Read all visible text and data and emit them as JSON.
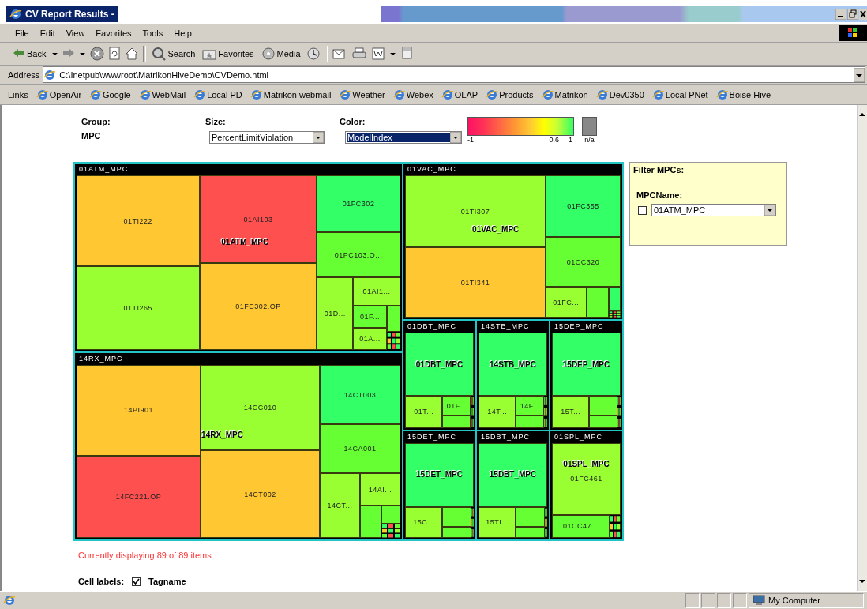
{
  "window": {
    "title": "CV Report Results -"
  },
  "menu": [
    "File",
    "Edit",
    "View",
    "Favorites",
    "Tools",
    "Help"
  ],
  "toolbar": [
    {
      "kind": "back",
      "label": "Back"
    },
    {
      "kind": "caret"
    },
    {
      "kind": "forward"
    },
    {
      "kind": "caret"
    },
    {
      "kind": "stop"
    },
    {
      "kind": "refresh"
    },
    {
      "kind": "home"
    },
    {
      "kind": "separator"
    },
    {
      "kind": "search",
      "label": "Search"
    },
    {
      "kind": "favorites",
      "label": "Favorites"
    },
    {
      "kind": "media",
      "label": "Media"
    },
    {
      "kind": "history"
    },
    {
      "kind": "separator"
    },
    {
      "kind": "mail"
    },
    {
      "kind": "print"
    },
    {
      "kind": "edit"
    },
    {
      "kind": "caret"
    },
    {
      "kind": "discuss"
    }
  ],
  "address": {
    "label": "Address",
    "value": "C:\\Inetpub\\wwwroot\\MatrikonHiveDemo\\CVDemo.html"
  },
  "links": {
    "label": "Links",
    "items": [
      "OpenAir",
      "Google",
      "WebMail",
      "Local PD",
      "Matrikon webmail",
      "Weather",
      "Webex",
      "OLAP",
      "Products",
      "Matrikon",
      "Dev0350",
      "Local PNet",
      "Boise Hive"
    ]
  },
  "controls": {
    "group": {
      "label": "Group:",
      "value": "MPC"
    },
    "size": {
      "label": "Size:",
      "value": "PercentLimitViolation",
      "highlighted": false
    },
    "color": {
      "label": "Color:",
      "value": "ModelIndex",
      "highlighted": true
    },
    "legend": {
      "ticks": [
        "-1",
        "0.6",
        "1"
      ],
      "na": "n/a"
    }
  },
  "treemap": {
    "groups": [
      {
        "title": "01ATM_MPC",
        "overlay_label": "01ATM_MPC",
        "cells": [
          {
            "kind": "tile",
            "label": "01TI222",
            "color": "#ffc833"
          },
          {
            "kind": "tile",
            "label": "01TI265",
            "color": "#99ff33"
          },
          {
            "kind": "tile",
            "label": "01AI103",
            "color": "#ff5050"
          },
          {
            "kind": "tile",
            "label": "01FC302.OP",
            "color": "#ffc833"
          },
          {
            "kind": "tile",
            "label": "01FC302",
            "color": "#33ff66"
          },
          {
            "kind": "tile",
            "label": "01PC103.O...",
            "color": "#66ff33"
          },
          {
            "kind": "tile",
            "label": "01D...",
            "color": "#99ff33"
          },
          {
            "kind": "tile",
            "label": "01AI1...",
            "color": "#99ff33"
          },
          {
            "kind": "tile",
            "label": "01F...",
            "color": "#66ff33"
          },
          {
            "kind": "tile",
            "label": "01A...",
            "color": "#99ff33"
          },
          {
            "kind": "tile",
            "color": "#66ff33"
          },
          {
            "kind": "mosaic"
          }
        ]
      },
      {
        "title": "01VAC_MPC",
        "overlay_label": "01VAC_MPC",
        "cells": [
          {
            "kind": "tile",
            "label": "01TI307",
            "color": "#99ff33"
          },
          {
            "kind": "tile",
            "label": "01TI341",
            "color": "#ffc833"
          },
          {
            "kind": "tile",
            "label": "01FC355",
            "color": "#33ff66"
          },
          {
            "kind": "tile",
            "label": "01CC320",
            "color": "#66ff33"
          },
          {
            "kind": "tile",
            "label": "01FC...",
            "color": "#99ff33"
          },
          {
            "kind": "tile",
            "color": "#66ff33"
          },
          {
            "kind": "tile",
            "color": "#33ff66"
          },
          {
            "kind": "mosaic"
          }
        ]
      },
      {
        "title": "14RX_MPC",
        "overlay_label": "14RX_MPC",
        "cells": [
          {
            "kind": "tile",
            "label": "14PI901",
            "color": "#ffc833"
          },
          {
            "kind": "tile",
            "label": "14FC221.OP",
            "color": "#ff5050"
          },
          {
            "kind": "tile",
            "label": "14CC010",
            "color": "#99ff33"
          },
          {
            "kind": "tile",
            "label": "14CT002",
            "color": "#ffc833"
          },
          {
            "kind": "tile",
            "label": "14CT003",
            "color": "#33ff66"
          },
          {
            "kind": "tile",
            "label": "14CA001",
            "color": "#66ff33"
          },
          {
            "kind": "tile",
            "label": "14CT...",
            "color": "#99ff33"
          },
          {
            "kind": "tile",
            "label": "14AI...",
            "color": "#99ff33"
          },
          {
            "kind": "tile",
            "color": "#66ff33"
          },
          {
            "kind": "tile",
            "color": "#66ff33"
          },
          {
            "kind": "mosaic"
          }
        ]
      },
      {
        "title": "01DBT_MPC",
        "overlay_label": "01DBT_MPC",
        "cells": [
          {
            "kind": "tile",
            "color": "#33ff66"
          },
          {
            "kind": "tile",
            "label": "01T...",
            "color": "#99ff33"
          },
          {
            "kind": "tile",
            "label": "01F...",
            "color": "#66ff33"
          },
          {
            "kind": "tile",
            "color": "#66ff33"
          },
          {
            "kind": "mosaic"
          }
        ]
      },
      {
        "title": "14STB_MPC",
        "overlay_label": "14STB_MPC",
        "cells": [
          {
            "kind": "tile",
            "color": "#33ff66"
          },
          {
            "kind": "tile",
            "label": "14T...",
            "color": "#99ff33"
          },
          {
            "kind": "tile",
            "label": "14F...",
            "color": "#66ff33"
          },
          {
            "kind": "tile",
            "color": "#66ff33"
          },
          {
            "kind": "mosaic"
          }
        ]
      },
      {
        "title": "15DEP_MPC",
        "overlay_label": "15DEP_MPC",
        "cells": [
          {
            "kind": "tile",
            "color": "#33ff66"
          },
          {
            "kind": "tile",
            "label": "15T...",
            "color": "#99ff33"
          },
          {
            "kind": "tile",
            "color": "#66ff33"
          },
          {
            "kind": "tile",
            "color": "#66ff33"
          },
          {
            "kind": "mosaic"
          }
        ]
      },
      {
        "title": "15DET_MPC",
        "overlay_label": "15DET_MPC",
        "cells": [
          {
            "kind": "tile",
            "color": "#33ff66"
          },
          {
            "kind": "tile",
            "label": "15C...",
            "color": "#99ff33"
          },
          {
            "kind": "tile",
            "color": "#66ff33"
          },
          {
            "kind": "tile",
            "color": "#66ff33"
          },
          {
            "kind": "mosaic"
          }
        ]
      },
      {
        "title": "15DBT_MPC",
        "overlay_label": "15DBT_MPC",
        "cells": [
          {
            "kind": "tile",
            "color": "#33ff66"
          },
          {
            "kind": "tile",
            "label": "15TI...",
            "color": "#99ff33"
          },
          {
            "kind": "tile",
            "color": "#66ff33"
          },
          {
            "kind": "tile",
            "color": "#66ff33"
          },
          {
            "kind": "mosaic"
          }
        ]
      },
      {
        "title": "01SPL_MPC",
        "overlay_label": "01SPL_MPC",
        "cells": [
          {
            "kind": "tile",
            "label": "01FC461",
            "color": "#99ff33"
          },
          {
            "kind": "tile",
            "label": "01CC47...",
            "color": "#66ff33"
          },
          {
            "kind": "mosaic"
          }
        ]
      }
    ]
  },
  "filter": {
    "title": "Filter MPCs:",
    "field_label": "MPCName:",
    "checked": false,
    "value": "01ATM_MPC"
  },
  "summary": "Currently displaying 89 of 89 items",
  "cell_labels": {
    "label": "Cell labels:",
    "checked": true,
    "option": "Tagname"
  },
  "status_bar": {
    "zone": "My Computer"
  }
}
